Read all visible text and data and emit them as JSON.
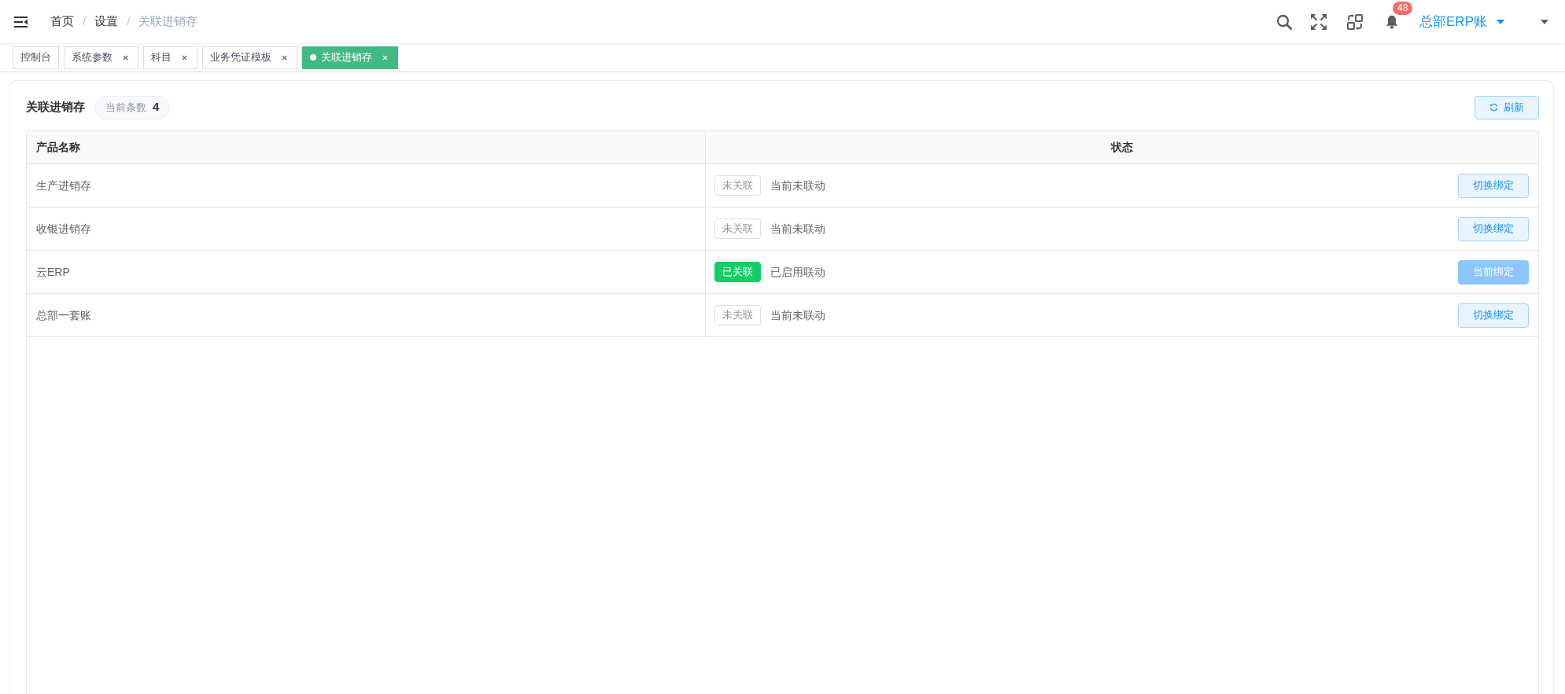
{
  "header": {
    "breadcrumb": [
      {
        "label": "首页",
        "current": false
      },
      {
        "separator": "/",
        "label": "设置",
        "current": false
      },
      {
        "separator": "/",
        "label": "关联进销存",
        "current": true
      }
    ],
    "notifications": "48",
    "account": "总部ERP账"
  },
  "tabs": [
    {
      "label": "控制台",
      "selected": false,
      "closable": false
    },
    {
      "label": "系统参数",
      "selected": false,
      "closable": true
    },
    {
      "label": "科目",
      "selected": false,
      "closable": true
    },
    {
      "label": "业务凭证模板",
      "selected": false,
      "closable": true
    },
    {
      "label": "关联进销存",
      "selected": true,
      "closable": true
    }
  ],
  "panel": {
    "title": "关联进销存",
    "count_label": "当前条数",
    "count": "4",
    "refresh_button": "刷新"
  },
  "table": {
    "columns": [
      "产品名称",
      "状态"
    ],
    "rows": [
      {
        "name": "生产进销存",
        "linked": false,
        "tag": "未关联",
        "status": "当前未联动",
        "button": {
          "label": "切换绑定",
          "disabled": false
        }
      },
      {
        "name": "收银进销存",
        "linked": false,
        "tag": "未关联",
        "status": "当前未联动",
        "button": {
          "label": "切换绑定",
          "disabled": false
        }
      },
      {
        "name": "云ERP",
        "linked": true,
        "tag": "已关联",
        "status": "已启用联动",
        "button": {
          "label": "当前绑定",
          "disabled": true
        }
      },
      {
        "name": "总部一套账",
        "linked": false,
        "tag": "未关联",
        "status": "当前未联动",
        "button": {
          "label": "切换绑定",
          "disabled": false
        }
      }
    ]
  }
}
